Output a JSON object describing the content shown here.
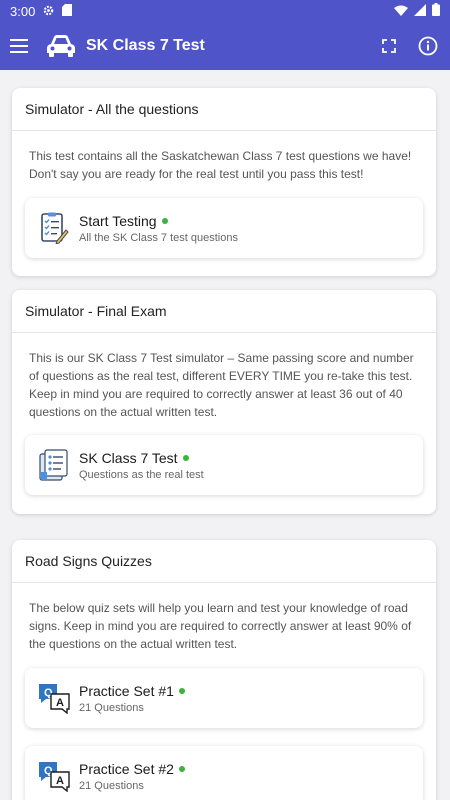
{
  "status_bar": {
    "time": "3:00"
  },
  "app_bar": {
    "title": "SK Class 7 Test"
  },
  "colors": {
    "primary": "#4f55c9",
    "status_dot": "#3db33d"
  },
  "sections": [
    {
      "title": "Simulator - All the questions",
      "description": "This test contains all the Saskatchewan Class 7 test questions we have! Don't say you are ready for the real test until you pass this test!",
      "items": [
        {
          "title": "Start Testing",
          "subtitle": "All the SK Class 7 test questions",
          "icon": "checklist-icon"
        }
      ]
    },
    {
      "title": "Simulator - Final Exam",
      "description": "This is our SK Class 7 Test simulator – Same passing score and number of questions as the real test, different EVERY TIME you re-take this test. Keep in mind you are required to correctly answer at least 36 out of 40 questions on the actual written test.",
      "items": [
        {
          "title": "SK Class 7 Test",
          "subtitle": "Questions as the real test",
          "icon": "exam-paper-icon"
        }
      ]
    },
    {
      "title": "Road Signs Quizzes",
      "description": "The below quiz sets will help you learn and test your knowledge of road signs. Keep in mind you are required to correctly answer at least 90% of the questions on the actual written test.",
      "items": [
        {
          "title": "Practice Set #1",
          "subtitle": "21 Questions",
          "icon": "qa-chat-icon"
        },
        {
          "title": "Practice Set #2",
          "subtitle": "21 Questions",
          "icon": "qa-chat-icon"
        }
      ]
    }
  ]
}
